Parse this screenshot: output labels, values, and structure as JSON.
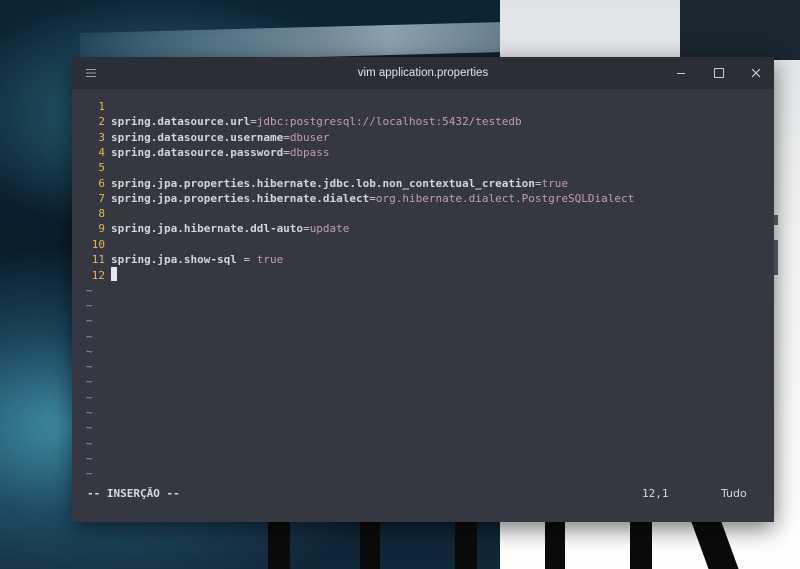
{
  "window": {
    "title": "vim application.properties"
  },
  "editor": {
    "lines": [
      {
        "num": "1",
        "key": "",
        "sep": "",
        "value": ""
      },
      {
        "num": "2",
        "key": "spring.datasource.url",
        "sep": "=",
        "value": "jdbc:postgresql://localhost:5432/testedb"
      },
      {
        "num": "3",
        "key": "spring.datasource.username",
        "sep": "=",
        "value": "dbuser"
      },
      {
        "num": "4",
        "key": "spring.datasource.password",
        "sep": "=",
        "value": "dbpass"
      },
      {
        "num": "5",
        "key": "",
        "sep": "",
        "value": ""
      },
      {
        "num": "6",
        "key": "spring.jpa.properties.hibernate.jdbc.lob.non_contextual_creation",
        "sep": "=",
        "value": "true"
      },
      {
        "num": "7",
        "key": "spring.jpa.properties.hibernate.dialect",
        "sep": "=",
        "value": "org.hibernate.dialect.PostgreSQLDialect"
      },
      {
        "num": "8",
        "key": "",
        "sep": "",
        "value": ""
      },
      {
        "num": "9",
        "key": "spring.jpa.hibernate.ddl-auto",
        "sep": "=",
        "value": "update"
      },
      {
        "num": "10",
        "key": "",
        "sep": "",
        "value": ""
      },
      {
        "num": "11",
        "key": "spring.jpa.show-sql",
        "sep": " = ",
        "value": "true"
      },
      {
        "num": "12",
        "key": "",
        "sep": "",
        "value": ""
      }
    ],
    "empty_line_marker": "~",
    "empty_line_count": 13
  },
  "status": {
    "mode": "-- INSERÇÃO --",
    "position": "12,1",
    "scroll": "Tudo"
  },
  "colors": {
    "line_number": "#e6b452",
    "key": "#d3d6dc",
    "value": "#c79bb0",
    "tilde": "#7ea0c8",
    "background": "#353841"
  },
  "icons": {
    "menu": "hamburger-icon",
    "minimize": "minimize-icon",
    "maximize": "maximize-icon",
    "close": "close-icon"
  }
}
